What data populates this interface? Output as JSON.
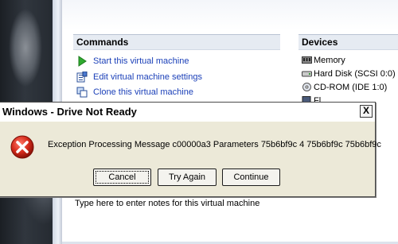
{
  "commands": {
    "header": "Commands",
    "items": [
      {
        "label": "Start this virtual machine",
        "icon": "play-icon"
      },
      {
        "label": "Edit virtual machine settings",
        "icon": "settings-icon"
      },
      {
        "label": "Clone this virtual machine",
        "icon": "clone-icon"
      }
    ]
  },
  "devices": {
    "header": "Devices",
    "items": [
      {
        "label": "Memory",
        "icon": "memory-icon"
      },
      {
        "label": "Hard Disk (SCSI 0:0)",
        "icon": "hard-disk-icon"
      },
      {
        "label": "CD-ROM (IDE 1:0)",
        "icon": "cdrom-icon"
      },
      {
        "label": "Fl",
        "icon": "floppy-icon"
      }
    ]
  },
  "notes": {
    "placeholder": "Type here to enter notes for this virtual machine"
  },
  "dialog": {
    "title": "Windows - Drive Not Ready",
    "close_label": "X",
    "message": "Exception Processing Message c00000a3 Parameters 75b6bf9c 4 75b6bf9c 75b6bf9c",
    "buttons": {
      "cancel": "Cancel",
      "try_again": "Try Again",
      "continue": "Continue"
    }
  },
  "colors": {
    "link": "#1a3fb8",
    "dialog_bg": "#ece9d8",
    "error_red": "#d42a1a"
  }
}
